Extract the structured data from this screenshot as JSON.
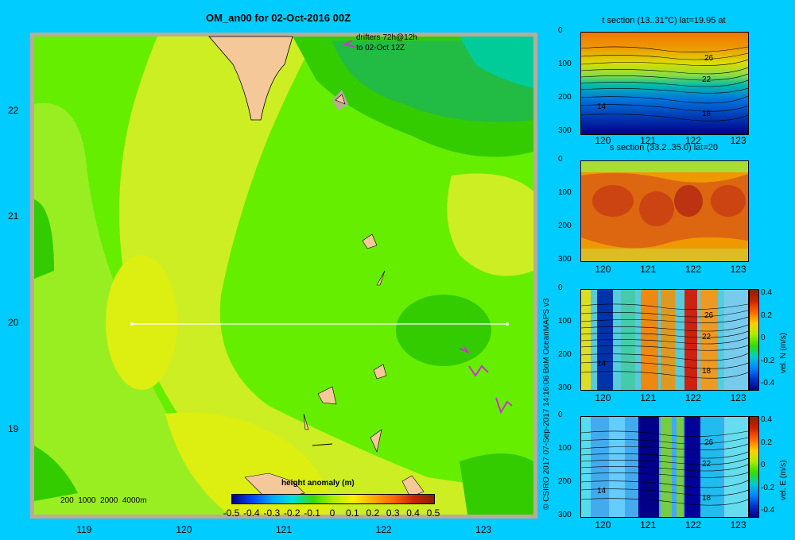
{
  "title": "OM_an00 for 02-Oct-2016 00Z",
  "credit": "© CSIRO 2017   07-Sep-2017 14:16:06 BoM OceanMAPS v3",
  "map": {
    "drifters_line1": "drifters 72h@12h",
    "drifters_line2": "to 02-Oct 12Z",
    "depth_legend": "200  1000  2000  4000m",
    "colorbar_label": "height anomaly  (m)",
    "colorbar_ticks": [
      "-0.5",
      "-0.4",
      "-0.3",
      "-0.2",
      "-0.1",
      "0",
      "0.1",
      "0.2",
      "0.3",
      "0.4",
      "0.5"
    ],
    "x_ticks": [
      "119",
      "120",
      "121",
      "122",
      "123"
    ],
    "y_ticks": [
      "22",
      "21",
      "20",
      "19"
    ]
  },
  "panels": [
    {
      "title": "t section (13..31°C) lat=19.95 at",
      "contour_labels": [
        "26",
        "22",
        "18",
        "14"
      ],
      "y_ticks": [
        "0",
        "100",
        "200",
        "300"
      ],
      "x_ticks": [
        "120",
        "121",
        "122",
        "123"
      ]
    },
    {
      "title": "s section (33.2..35.0) lat=20",
      "y_ticks": [
        "0",
        "100",
        "200",
        "300"
      ],
      "x_ticks": [
        "120",
        "121",
        "122",
        "123"
      ]
    },
    {
      "title": "",
      "contour_labels": [
        "26",
        "22",
        "18",
        "14"
      ],
      "y_ticks": [
        "0",
        "100",
        "200",
        "300"
      ],
      "x_ticks": [
        "120",
        "121",
        "122",
        "123"
      ],
      "cbar_ticks": [
        "0.4",
        "0.2",
        "0",
        "-0.2",
        "-0.4"
      ],
      "cbar_label": "vel. N (m/s)"
    },
    {
      "title": "",
      "contour_labels": [
        "26",
        "22",
        "18",
        "14"
      ],
      "y_ticks": [
        "0",
        "100",
        "200",
        "300"
      ],
      "x_ticks": [
        "120",
        "121",
        "122",
        "123"
      ],
      "cbar_ticks": [
        "0.4",
        "0.2",
        "0",
        "-0.2",
        "-0.4"
      ],
      "cbar_label": "vel. E (m/s)"
    }
  ],
  "chart_data": [
    {
      "type": "heatmap",
      "title": "OM_an00 for 02-Oct-2016 00Z",
      "quantity": "height anomaly (m)",
      "xlim": [
        118.5,
        123.5
      ],
      "ylim": [
        18.2,
        22.7
      ],
      "x_ticks": [
        119,
        120,
        121,
        122,
        123
      ],
      "y_ticks": [
        19,
        20,
        21,
        22
      ],
      "colorbar_range": [
        -0.5,
        0.5
      ],
      "section_line": {
        "lat": 20,
        "lon": [
          119.5,
          123.2
        ]
      }
    },
    {
      "type": "heatmap",
      "title": "t section (13..31°C) lat=19.95 at",
      "xlim": [
        119.5,
        123.2
      ],
      "ylim": [
        300,
        0
      ],
      "contour_labels": [
        26,
        22,
        18,
        14
      ]
    },
    {
      "type": "heatmap",
      "title": "s section (33.2..35.0) lat=20",
      "xlim": [
        119.5,
        123.2
      ],
      "ylim": [
        300,
        0
      ]
    },
    {
      "type": "heatmap",
      "quantity": "vel. N (m/s)",
      "xlim": [
        119.5,
        123.2
      ],
      "ylim": [
        300,
        0
      ],
      "colorbar_range": [
        -0.4,
        0.4
      ],
      "contour_labels": [
        26,
        22,
        18,
        14
      ]
    },
    {
      "type": "heatmap",
      "quantity": "vel. E (m/s)",
      "xlim": [
        119.5,
        123.2
      ],
      "ylim": [
        300,
        0
      ],
      "colorbar_range": [
        -0.4,
        0.4
      ],
      "contour_labels": [
        26,
        22,
        18,
        14
      ]
    }
  ]
}
